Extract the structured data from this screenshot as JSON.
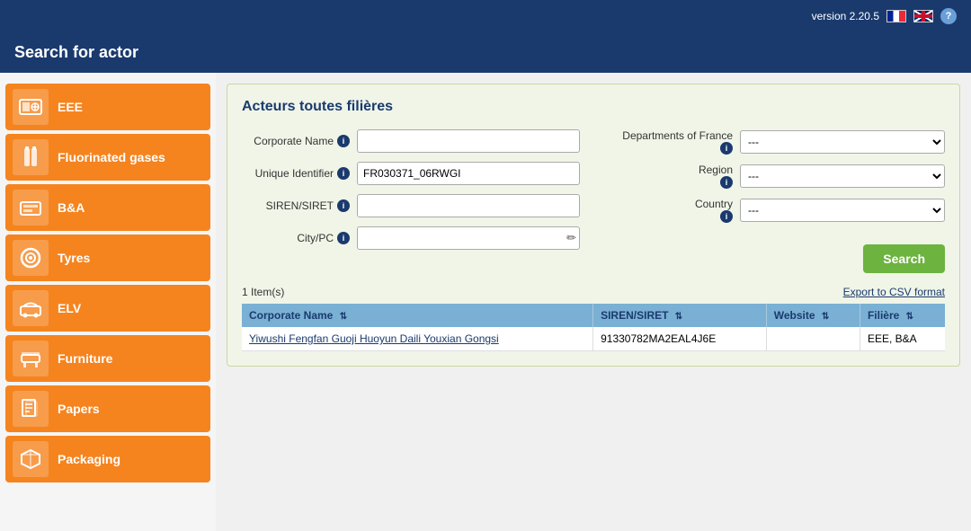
{
  "app": {
    "version": "version 2.20.5",
    "title": "Search for actor",
    "help_label": "?"
  },
  "flags": {
    "fr_label": "French",
    "uk_label": "English"
  },
  "sidebar": {
    "items": [
      {
        "id": "eee",
        "label": "EEE",
        "icon": "eee"
      },
      {
        "id": "fluorinated-gases",
        "label": "Fluorinated gases",
        "icon": "gas"
      },
      {
        "id": "ba",
        "label": "B&A",
        "icon": "ba"
      },
      {
        "id": "tyres",
        "label": "Tyres",
        "icon": "tyres"
      },
      {
        "id": "elv",
        "label": "ELV",
        "icon": "elv"
      },
      {
        "id": "furniture",
        "label": "Furniture",
        "icon": "furniture"
      },
      {
        "id": "papers",
        "label": "Papers",
        "icon": "papers"
      },
      {
        "id": "packaging",
        "label": "Packaging",
        "icon": "packaging"
      }
    ]
  },
  "search_panel": {
    "title": "Acteurs toutes filières",
    "fields": {
      "corporate_name_label": "Corporate Name",
      "corporate_name_value": "",
      "unique_identifier_label": "Unique Identifier",
      "unique_identifier_value": "FR030371_06RWGI",
      "siren_siret_label": "SIREN/SIRET",
      "siren_siret_value": "",
      "city_pc_label": "City/PC",
      "city_pc_value": "",
      "departments_label": "Departments of France",
      "departments_value": "---",
      "region_label": "Region",
      "region_value": "---",
      "country_label": "Country",
      "country_value": "---"
    },
    "search_button": "Search",
    "export_link": "Export to CSV format",
    "results_count": "1 Item(s)"
  },
  "table": {
    "columns": [
      {
        "id": "corporate_name",
        "label": "Corporate Name",
        "sortable": true
      },
      {
        "id": "siren_siret",
        "label": "SIREN/SIRET",
        "sortable": true
      },
      {
        "id": "website",
        "label": "Website",
        "sortable": true
      },
      {
        "id": "filiere",
        "label": "Filière",
        "sortable": true
      }
    ],
    "rows": [
      {
        "corporate_name": "Yiwushi Fengfan Guoji Huoyun Daili Youxian Gongsi",
        "siren_siret": "91330782MA2EAL4J6E",
        "website": "",
        "filiere": "EEE, B&A"
      }
    ]
  },
  "icons": {
    "sort": "⇅",
    "edit": "✏",
    "info": "i"
  }
}
